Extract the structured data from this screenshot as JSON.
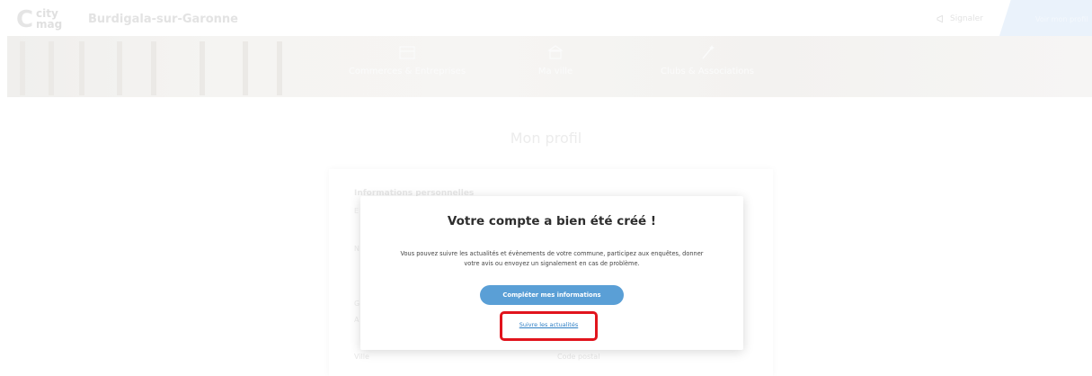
{
  "header": {
    "logo": {
      "letter": "C",
      "line1": "city",
      "line2": "mag"
    },
    "city_name": "Burdigala-sur-Garonne",
    "signaler_label": "Signaler",
    "cta_label": "Voir mon profil",
    "cta_color": "#eaf2fb"
  },
  "hero": {
    "nav": [
      {
        "label": "Commerces & Entreprises",
        "icon": "storefront-icon"
      },
      {
        "label": "Ma ville",
        "icon": "city-hall-icon"
      },
      {
        "label": "Clubs & Associations",
        "icon": "wand-icon"
      }
    ]
  },
  "page": {
    "title": "Mon profil"
  },
  "profile_form": {
    "section_title": "Informations personnelles",
    "fragments": [
      "E",
      "N",
      "G",
      "A"
    ],
    "field_labels": {
      "left": "Ville",
      "right": "Code postal"
    }
  },
  "modal": {
    "title": "Votre compte a bien été créé !",
    "body": "Vous pouvez suivre les actualités et évènements de votre commune, participez aux enquêtes, donner votre avis ou envoyez un signalement en cas de problème.",
    "primary_button": "Compléter mes informations",
    "secondary_link": "Suivre les actualités",
    "colors": {
      "primary": "#5a9fd6",
      "link": "#2d7ec4",
      "highlight": "#e1141d"
    }
  }
}
